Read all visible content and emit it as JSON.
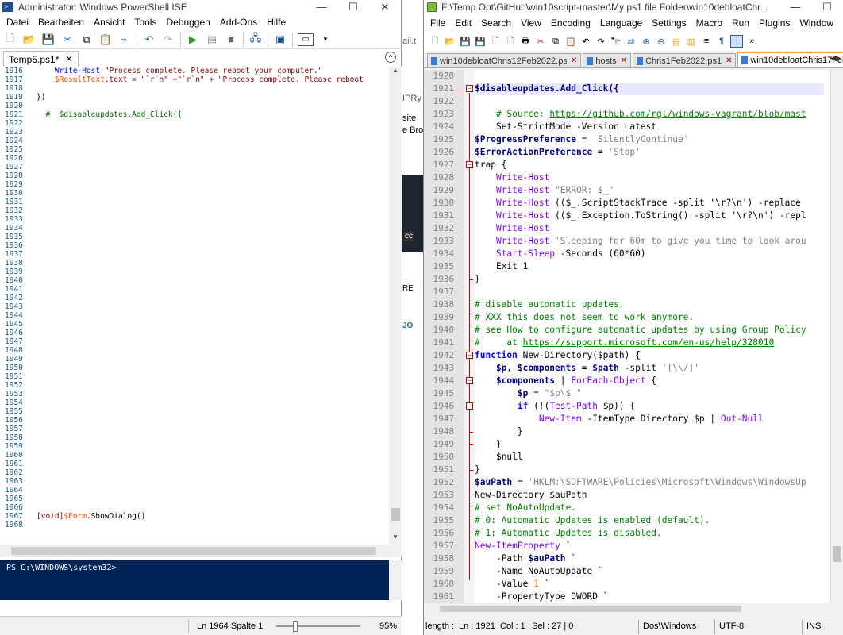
{
  "ise": {
    "title": "Administrator: Windows PowerShell ISE",
    "menu": [
      "Datei",
      "Bearbeiten",
      "Ansicht",
      "Tools",
      "Debuggen",
      "Add-Ons",
      "Hilfe"
    ],
    "tab": "Temp5.ps1*",
    "line_numbers": [
      "1916",
      "1917",
      "1918",
      "1919",
      "1920",
      "1921",
      "1922",
      "1923",
      "1924",
      "1925",
      "1926",
      "1927",
      "1928",
      "1929",
      "1930",
      "1931",
      "1932",
      "1933",
      "1934",
      "1935",
      "1936",
      "1937",
      "1938",
      "1939",
      "1940",
      "1941",
      "1942",
      "1943",
      "1944",
      "1945",
      "1946",
      "1947",
      "1948",
      "1949",
      "1950",
      "1951",
      "1952",
      "1953",
      "1954",
      "1955",
      "1956",
      "1957",
      "1958",
      "1959",
      "1960",
      "1961",
      "1962",
      "1963",
      "1964",
      "1965",
      "1966",
      "1967",
      "1968"
    ],
    "code": {
      "l1916_cmd": "Write-Host",
      "l1916_str": " \"Process complete. Please reboot your computer.\"",
      "l1917_var": "$ResultText",
      "l1917_rest": ".text = \"`r`n\" +\"`r`n\" + \"Process complete. Please reboot",
      "l1919": "})",
      "l1921_hash": "#",
      "l1921_rest": "  $disableupdates.Add_Click({",
      "l1967_a": "[void]",
      "l1967_var": "$Form",
      "l1967_b": ".ShowDialog()"
    },
    "console_prompt": "PS C:\\WINDOWS\\system32>",
    "status": {
      "position": "Ln 1964  Spalte 1",
      "zoom": "95%"
    }
  },
  "background": {
    "pieces": [
      "ail.t",
      "IPRy",
      "site",
      "e Bro",
      "cc",
      "RE",
      "JO"
    ]
  },
  "npp": {
    "title": "F:\\Temp Opt\\GitHub\\win10script-master\\My ps1 file Folder\\win10debloatChr...",
    "menu": [
      "File",
      "Edit",
      "Search",
      "View",
      "Encoding",
      "Language",
      "Settings",
      "Macro",
      "Run",
      "Plugins",
      "Window",
      "?"
    ],
    "tabs": [
      "win10debloatChris12Feb2022.ps1",
      "hosts",
      "Chris1Feb2022.ps1",
      "win10debloatChris17Feb2022"
    ],
    "line_numbers": [
      "1920",
      "1921",
      "1922",
      "1923",
      "1924",
      "1925",
      "1926",
      "1927",
      "1928",
      "1929",
      "1930",
      "1931",
      "1932",
      "1933",
      "1934",
      "1935",
      "1936",
      "1937",
      "1938",
      "1939",
      "1940",
      "1941",
      "1942",
      "1943",
      "1944",
      "1945",
      "1946",
      "1947",
      "1948",
      "1949",
      "1950",
      "1951",
      "1952",
      "1953",
      "1954",
      "1955",
      "1956",
      "1957",
      "1958",
      "1959",
      "1960",
      "1961"
    ],
    "code": {
      "l1921": "$disableupdates.Add_Click({",
      "l1923_com": "# Source: ",
      "l1923_link": "https://github.com/rgl/windows-vagrant/blob/mast",
      "l1924": "Set-StrictMode -Version Latest",
      "l1925_var": "$ProgressPreference",
      "l1925_str": "'SilentlyContinue'",
      "l1926_var": "$ErrorActionPreference",
      "l1926_str": "'Stop'",
      "l1927": "trap {",
      "write_host": "Write-Host",
      "l1929_str": "\"ERROR: $_\"",
      "l1930_rest": " (($_.ScriptStackTrace -split '\\r?\\n') -replace",
      "l1931_rest": " (($_.Exception.ToString() -split '\\r?\\n') -repl",
      "l1933_str": " 'Sleeping for 60m to give you time to look arou",
      "l1934_cmd": "Start-Sleep",
      "l1934_rest": " -Seconds (60*60)",
      "l1935": "Exit 1",
      "close_brace": "}",
      "l1938": "# disable automatic updates.",
      "l1939": "# XXX this does not seem to work anymore.",
      "l1940": "# see How to configure automatic updates by using Group Policy",
      "l1941_com": "#     at ",
      "l1941_link": "https://support.microsoft.com/en-us/help/328010",
      "l1942_kw": "function",
      "l1942_rest": " New-Directory($path) {",
      "l1943_a": "$p, $components",
      "l1943_b": " = ",
      "l1943_c": "$path",
      "l1943_d": " -split ",
      "l1943_e": "'[\\\\/]'",
      "l1944_a": "$components",
      "l1944_b": " | ",
      "l1944_c": "ForEach-Object",
      "l1944_d": " {",
      "l1945_a": "$p",
      "l1945_b": " = ",
      "l1945_c": "\"$p\\$_\"",
      "l1946_a": "if",
      "l1946_b": " (!(",
      "l1946_c": "Test-Path",
      "l1946_d": " $p)) {",
      "l1947_a": "New-Item",
      "l1947_b": " -ItemType Directory $p | ",
      "l1947_c": "Out-Null",
      "l1950": "$null",
      "l1952_var": "$auPath",
      "l1952_str": "'HKLM:\\SOFTWARE\\Policies\\Microsoft\\Windows\\WindowsUp",
      "l1953": "New-Directory $auPath",
      "l1954": "# set NoAutoUpdate.",
      "l1955": "# 0: Automatic Updates is enabled (default).",
      "l1956": "# 1: Automatic Updates is disabled.",
      "l1957_cmd": "New-ItemProperty",
      "l1957_rest": " `",
      "l1958_a": "-Path ",
      "l1958_b": "$auPath",
      "l1958_c": " `",
      "l1959": "-Name NoAutoUpdate `",
      "l1960_a": "-Value ",
      "l1960_b": "1",
      "l1960_c": " `",
      "l1961": "-PropertyType DWORD `"
    },
    "status": {
      "length": "length :",
      "ln": "Ln : 1921",
      "col": "Col : 1",
      "sel": "Sel : 27 | 0",
      "eol": "Dos\\Windows",
      "enc": "UTF-8",
      "ins": "INS"
    }
  }
}
